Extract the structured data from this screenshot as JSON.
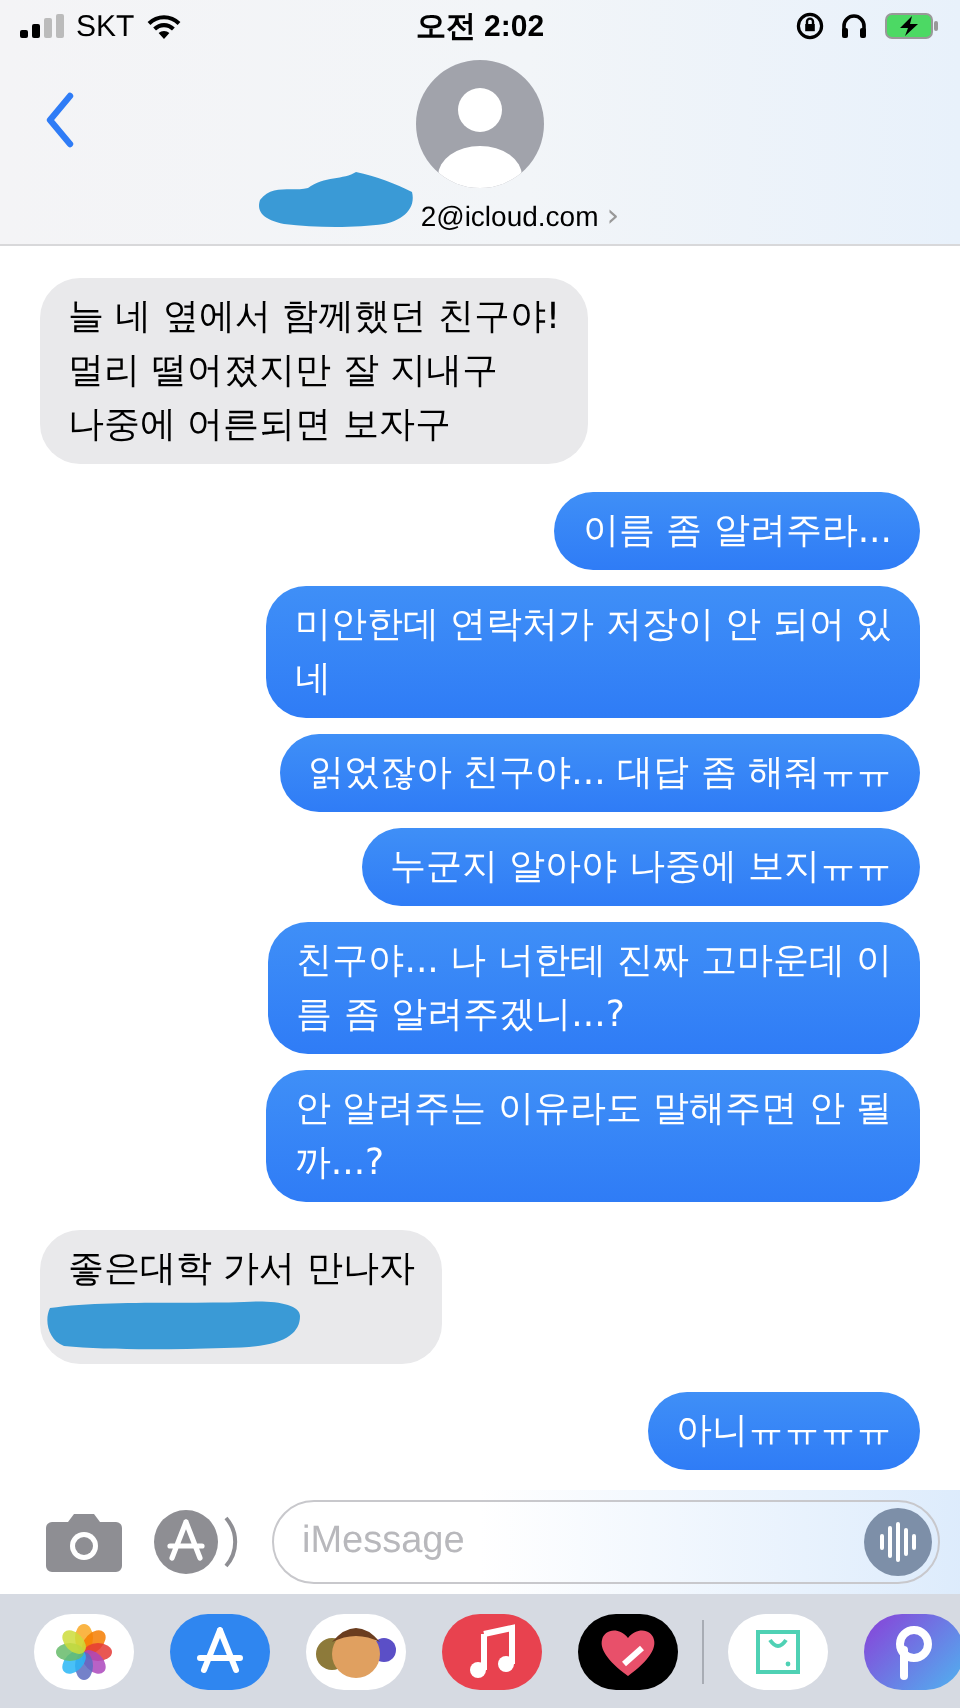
{
  "status_bar": {
    "carrier": "SKT",
    "time": "오전 2:02"
  },
  "header": {
    "contact": "2@icloud.com",
    "chevron": "›"
  },
  "messages": [
    {
      "kind": "received",
      "lines": [
        "늘 네 옆에서 함께했던 친구야!",
        "멀리 떨어졌지만 잘 지내구",
        "나중에 어른되면 보자구"
      ],
      "redacted": false
    },
    {
      "kind": "sent",
      "lines": [
        "이름 좀 알려주라..."
      ]
    },
    {
      "kind": "sent",
      "lines": [
        "미안한데 연락처가 저장이 안 되어 있",
        "네"
      ]
    },
    {
      "kind": "sent",
      "lines": [
        "읽었잖아 친구야... 대답 좀 해줘ㅠㅠ"
      ]
    },
    {
      "kind": "sent",
      "lines": [
        "누군지 알아야 나중에 보지ㅠㅠ"
      ]
    },
    {
      "kind": "sent",
      "lines": [
        "친구야... 나 너한테 진짜 고마운데 이",
        "름 좀 알려주겠니...?"
      ]
    },
    {
      "kind": "sent",
      "lines": [
        "안 알려주는 이유라도 말해주면 안 될",
        "까...?"
      ]
    },
    {
      "kind": "received",
      "lines": [
        "좋은대학 가서 만나자"
      ],
      "redacted": true
    },
    {
      "kind": "sent",
      "lines": [
        "아니ㅠㅠㅠㅠ"
      ]
    }
  ],
  "composer": {
    "placeholder": "iMessage"
  }
}
